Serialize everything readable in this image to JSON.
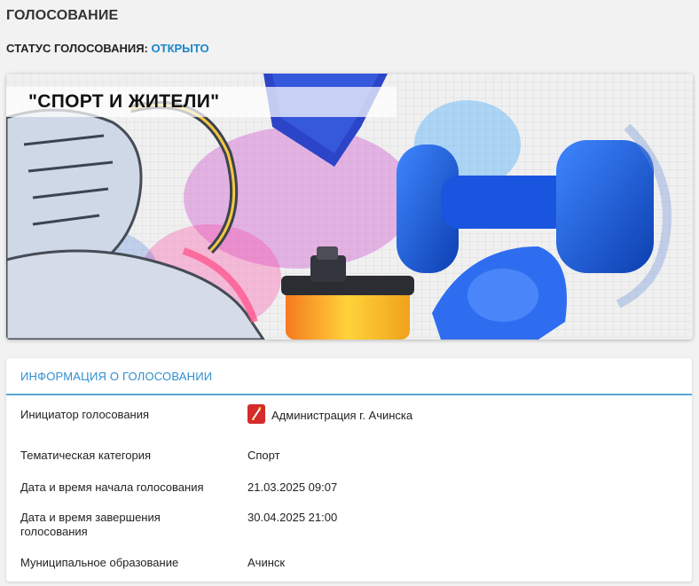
{
  "page": {
    "title": "ГОЛОСОВАНИЕ",
    "status_label": "СТАТУС ГОЛОСОВАНИЯ:",
    "status_value": "ОТКРЫТО"
  },
  "banner": {
    "title": "\"СПОРТ И ЖИТЕЛИ\""
  },
  "info": {
    "header": "ИНФОРМАЦИЯ О ГОЛОСОВАНИИ",
    "rows": [
      {
        "label": "Инициатор голосования",
        "value": "Администрация г. Ачинска"
      },
      {
        "label": "Тематическая категория",
        "value": "Спорт"
      },
      {
        "label": "Дата и время начала голосования",
        "value": "21.03.2025 09:07"
      },
      {
        "label": "Дата и время завершения голосования",
        "value": "30.04.2025 21:00"
      },
      {
        "label": "Муниципальное образование",
        "value": "Ачинск"
      }
    ]
  },
  "icons": {
    "initiator": "municipal-coat-of-arms-icon"
  },
  "colors": {
    "accent": "#1a86c9",
    "header_underline": "#5aa6d6",
    "icon_red": "#d42b2b"
  }
}
